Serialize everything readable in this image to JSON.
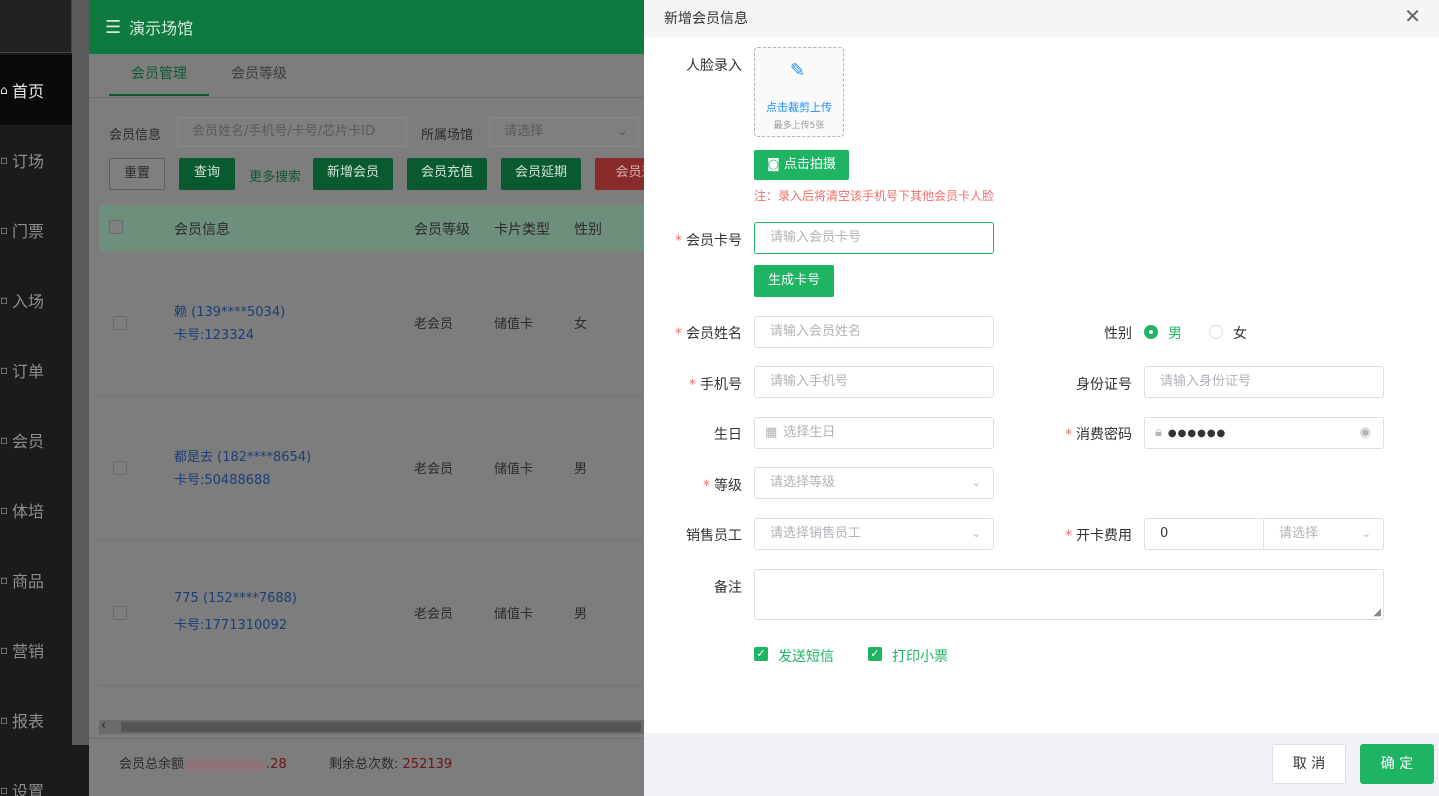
{
  "sidebar": {
    "items": [
      {
        "label": "首页",
        "icon": "home-icon",
        "active": true
      },
      {
        "label": "订场",
        "icon": "calendar-icon"
      },
      {
        "label": "门票",
        "icon": "ticket-icon"
      },
      {
        "label": "入场",
        "icon": "entry-icon"
      },
      {
        "label": "订单",
        "icon": "order-icon"
      },
      {
        "label": "会员",
        "icon": "member-icon"
      },
      {
        "label": "体培",
        "icon": "training-icon"
      },
      {
        "label": "商品",
        "icon": "goods-icon"
      },
      {
        "label": "营销",
        "icon": "marketing-icon"
      },
      {
        "label": "报表",
        "icon": "report-icon"
      },
      {
        "label": "设置",
        "icon": "settings-icon"
      }
    ]
  },
  "header": {
    "venue": "演示场馆"
  },
  "tabs": [
    {
      "label": "会员管理"
    },
    {
      "label": "会员等级"
    }
  ],
  "filters": {
    "member_info_label": "会员信息",
    "member_info_placeholder": "会员姓名/手机号/卡号/芯片卡ID",
    "venue_label": "所属场馆",
    "venue_placeholder": "请选择"
  },
  "toolbar": {
    "reset": "重置",
    "query": "查询",
    "more_search": "更多搜索",
    "add_member": "新增会员",
    "recharge": "会员充值",
    "extend": "会员延期",
    "refund_partial": "会员退"
  },
  "table": {
    "columns": [
      "会员信息",
      "会员等级",
      "卡片类型",
      "性别"
    ],
    "rows": [
      {
        "name": "赖 (139****5034)",
        "card": "卡号:123324",
        "level": "老会员",
        "card_type": "储值卡",
        "gender": "女"
      },
      {
        "name": "都是去 (182****8654)",
        "card": "卡号:50488688",
        "level": "老会员",
        "card_type": "储值卡",
        "gender": "男"
      },
      {
        "name": "775 (152****7688)",
        "card": "卡号:1771310092",
        "level": "老会员",
        "card_type": "储值卡",
        "gender": "男"
      }
    ]
  },
  "footer": {
    "balance_label": "会员总余额",
    "balance_suffix": ".28",
    "remaining_label": "剩余总次数:",
    "remaining_value": "252139"
  },
  "drawer": {
    "title": "新增会员信息",
    "face_label": "人脸录入",
    "upload_text": "点击裁剪上传",
    "upload_limit": "最多上传5张",
    "photo_button": "点击拍摄",
    "face_note": "注：录入后将清空该手机号下其他会员卡人脸",
    "card_label": "会员卡号",
    "card_placeholder": "请输入会员卡号",
    "generate_button": "生成卡号",
    "name_label": "会员姓名",
    "name_placeholder": "请输入会员姓名",
    "gender_label": "性别",
    "gender_male": "男",
    "gender_female": "女",
    "phone_label": "手机号",
    "phone_placeholder": "请输入手机号",
    "id_label": "身份证号",
    "id_placeholder": "请输入身份证号",
    "birthday_label": "生日",
    "birthday_placeholder": "选择生日",
    "password_label": "消费密码",
    "password_value": "●●●●●●",
    "level_label": "等级",
    "level_placeholder": "请选择等级",
    "staff_label": "销售员工",
    "staff_placeholder": "请选择销售员工",
    "fee_label": "开卡费用",
    "fee_value": "0",
    "fee_unit_placeholder": "请选择",
    "remark_label": "备注",
    "sms_label": "发送短信",
    "receipt_label": "打印小票",
    "cancel": "取 消",
    "confirm": "确 定"
  }
}
